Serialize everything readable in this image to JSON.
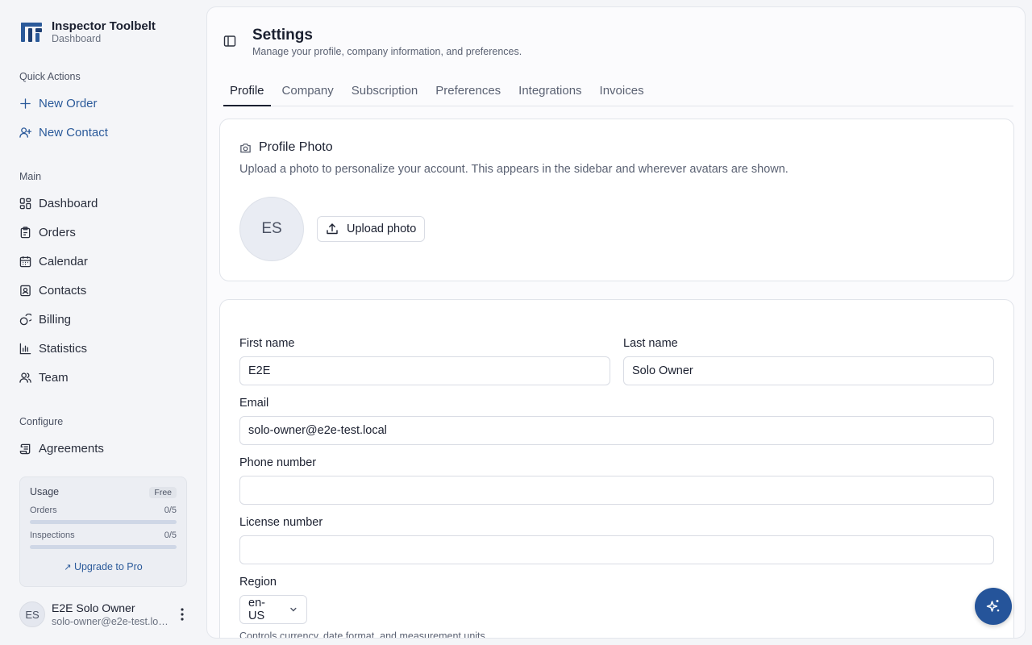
{
  "brand": {
    "name": "Inspector Toolbelt",
    "subtitle": "Dashboard"
  },
  "sidebar": {
    "quick_actions_label": "Quick Actions",
    "quick_actions": [
      {
        "label": "New Order",
        "icon": "plus-icon"
      },
      {
        "label": "New Contact",
        "icon": "user-plus-icon"
      }
    ],
    "main_label": "Main",
    "main_items": [
      {
        "label": "Dashboard",
        "icon": "grid-icon"
      },
      {
        "label": "Orders",
        "icon": "clipboard-icon"
      },
      {
        "label": "Calendar",
        "icon": "calendar-icon"
      },
      {
        "label": "Contacts",
        "icon": "contact-card-icon"
      },
      {
        "label": "Billing",
        "icon": "coins-icon"
      },
      {
        "label": "Statistics",
        "icon": "bar-chart-icon"
      },
      {
        "label": "Team",
        "icon": "users-icon"
      }
    ],
    "configure_label": "Configure",
    "configure_items": [
      {
        "label": "Agreements",
        "icon": "scroll-icon"
      }
    ]
  },
  "usage": {
    "title": "Usage",
    "plan": "Free",
    "rows": [
      {
        "label": "Orders",
        "value": "0/5",
        "progress": 0
      },
      {
        "label": "Inspections",
        "value": "0/5",
        "progress": 0
      }
    ],
    "upgrade_label": "Upgrade to Pro"
  },
  "user": {
    "initials": "ES",
    "name": "E2E Solo Owner",
    "email": "solo-owner@e2e-test.local"
  },
  "page": {
    "title": "Settings",
    "description": "Manage your profile, company information, and preferences."
  },
  "tabs": [
    {
      "label": "Profile",
      "active": true
    },
    {
      "label": "Company"
    },
    {
      "label": "Subscription"
    },
    {
      "label": "Preferences"
    },
    {
      "label": "Integrations"
    },
    {
      "label": "Invoices"
    }
  ],
  "photo_card": {
    "title": "Profile Photo",
    "description": "Upload a photo to personalize your account. This appears in the sidebar and wherever avatars are shown.",
    "initials": "ES",
    "upload_label": "Upload photo"
  },
  "form": {
    "first_name": {
      "label": "First name",
      "value": "E2E"
    },
    "last_name": {
      "label": "Last name",
      "value": "Solo Owner"
    },
    "email": {
      "label": "Email",
      "value": "solo-owner@e2e-test.local"
    },
    "phone": {
      "label": "Phone number",
      "value": ""
    },
    "license": {
      "label": "License number",
      "value": ""
    },
    "region": {
      "label": "Region",
      "value": "en-US",
      "hint": "Controls currency, date format, and measurement units."
    }
  },
  "colors": {
    "accent": "#2b5a9a",
    "fab": "#25549a"
  }
}
